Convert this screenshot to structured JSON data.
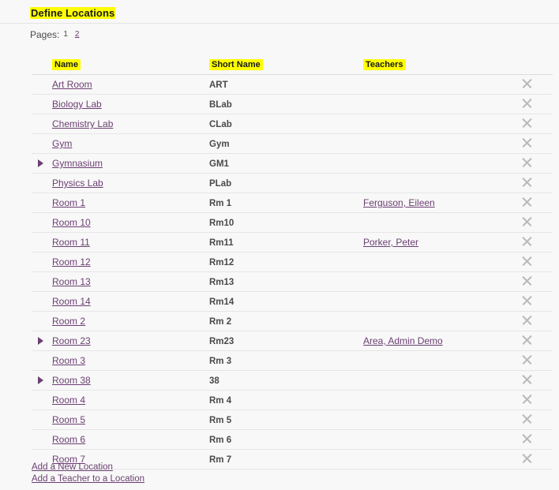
{
  "page": {
    "title": "Define Locations"
  },
  "pagination": {
    "label": "Pages:",
    "current": "1",
    "other": "2"
  },
  "table": {
    "headers": {
      "name": "Name",
      "short_name": "Short Name",
      "teachers": "Teachers"
    },
    "rows": [
      {
        "expandable": false,
        "name": "Art Room",
        "short_name": "ART",
        "teacher": ""
      },
      {
        "expandable": false,
        "name": "Biology Lab",
        "short_name": "BLab",
        "teacher": ""
      },
      {
        "expandable": false,
        "name": "Chemistry Lab",
        "short_name": "CLab",
        "teacher": ""
      },
      {
        "expandable": false,
        "name": "Gym",
        "short_name": "Gym",
        "teacher": ""
      },
      {
        "expandable": true,
        "name": "Gymnasium",
        "short_name": "GM1",
        "teacher": ""
      },
      {
        "expandable": false,
        "name": "Physics Lab",
        "short_name": "PLab",
        "teacher": ""
      },
      {
        "expandable": false,
        "name": "Room 1",
        "short_name": "Rm 1",
        "teacher": "Ferguson, Eileen"
      },
      {
        "expandable": false,
        "name": "Room 10",
        "short_name": "Rm10",
        "teacher": ""
      },
      {
        "expandable": false,
        "name": "Room 11",
        "short_name": "Rm11",
        "teacher": "Porker, Peter"
      },
      {
        "expandable": false,
        "name": "Room 12",
        "short_name": "Rm12",
        "teacher": ""
      },
      {
        "expandable": false,
        "name": "Room 13",
        "short_name": "Rm13",
        "teacher": ""
      },
      {
        "expandable": false,
        "name": "Room 14",
        "short_name": "Rm14",
        "teacher": ""
      },
      {
        "expandable": false,
        "name": "Room 2",
        "short_name": "Rm 2",
        "teacher": ""
      },
      {
        "expandable": true,
        "name": "Room 23",
        "short_name": "Rm23",
        "teacher": "Area, Admin Demo"
      },
      {
        "expandable": false,
        "name": "Room 3",
        "short_name": "Rm 3",
        "teacher": ""
      },
      {
        "expandable": true,
        "name": "Room 38",
        "short_name": "38",
        "teacher": ""
      },
      {
        "expandable": false,
        "name": "Room 4",
        "short_name": "Rm 4",
        "teacher": ""
      },
      {
        "expandable": false,
        "name": "Room 5",
        "short_name": "Rm 5",
        "teacher": ""
      },
      {
        "expandable": false,
        "name": "Room 6",
        "short_name": "Rm 6",
        "teacher": ""
      },
      {
        "expandable": false,
        "name": "Room 7",
        "short_name": "Rm 7",
        "teacher": ""
      }
    ],
    "delete_icon": "close-x-icon",
    "expander_icon": "triangle-right-icon"
  },
  "footer": {
    "links": [
      "Add a New Location",
      "Add a Teacher to a Location"
    ]
  },
  "colors": {
    "highlight": "#ffff00",
    "link": "#6b3f72",
    "background": "#f8f8f8",
    "row_border": "#e6e6e6",
    "delete_icon": "#b9b9b9"
  }
}
